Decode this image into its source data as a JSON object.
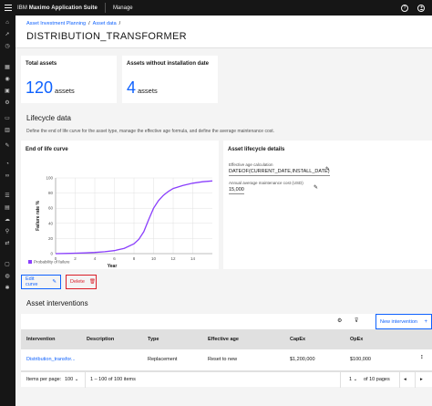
{
  "topbar": {
    "brand_prefix": "IBM",
    "brand_name": "Maximo Application Suite",
    "app_name": "Manage"
  },
  "breadcrumb": {
    "items": [
      "Asset Investment Planning",
      "Asset data"
    ]
  },
  "page_title": "DISTRIBUTION_TRANSFORMER",
  "tiles": {
    "total": {
      "label": "Total assets",
      "value": "120",
      "unit": "assets"
    },
    "no_install": {
      "label": "Assets without installation date",
      "value": "4",
      "unit": "assets"
    }
  },
  "lifecycle": {
    "title": "Lifecycle data",
    "description": "Define the end of life curve for the asset type, manage the effective age formula, and define the average maintenance cost."
  },
  "chart_data": {
    "type": "line",
    "title": "End of life curve",
    "xlabel": "Year",
    "ylabel": "Failure rate %",
    "xlim": [
      0,
      16
    ],
    "ylim": [
      0,
      100
    ],
    "xticks": [
      "0",
      "2",
      "4",
      "6",
      "8",
      "10",
      "12",
      "14"
    ],
    "yticks": [
      "0",
      "20",
      "40",
      "60",
      "80",
      "100"
    ],
    "grid": true,
    "legend": "bottom-left",
    "series": [
      {
        "name": "Probability of failure",
        "color": "#8a3ffc",
        "x": [
          0,
          1,
          2,
          3,
          4,
          5,
          6,
          7,
          8,
          8.5,
          9,
          9.5,
          10,
          10.5,
          11,
          11.5,
          12,
          13,
          14,
          15,
          16
        ],
        "y": [
          0,
          0.3,
          0.6,
          1,
          1.6,
          2.5,
          4,
          7,
          13,
          19,
          29,
          45,
          60,
          70,
          77,
          82,
          86,
          90,
          93,
          95,
          96
        ]
      }
    ]
  },
  "details": {
    "title": "Asset lifecycle details",
    "effective_age_label": "Effective age calculation",
    "effective_age_value": "DATEOF(CURRENT_DATE,INSTALL_DATE)",
    "maintenance_label": "Annual average maintenance cost (USD)",
    "maintenance_value": "15,000"
  },
  "buttons": {
    "edit_curve": "Edit curve",
    "delete": "Delete",
    "new_intervention": "New intervention"
  },
  "interventions": {
    "title": "Asset interventions",
    "columns": [
      "Intervention",
      "Description",
      "Type",
      "Effective age",
      "CapEx",
      "OpEx"
    ],
    "rows": [
      {
        "intervention": "Distribution_transfor...",
        "description": "",
        "type": "Replacement",
        "effective_age": "Reset to new",
        "capex": "$1,200,000",
        "opex": "$100,000"
      }
    ]
  },
  "pager": {
    "items_per_page_label": "Items per page:",
    "items_per_page_value": "100",
    "range_text": "1 – 100 of 100 items",
    "page_value": "1",
    "of_pages": "of 10 pages"
  }
}
